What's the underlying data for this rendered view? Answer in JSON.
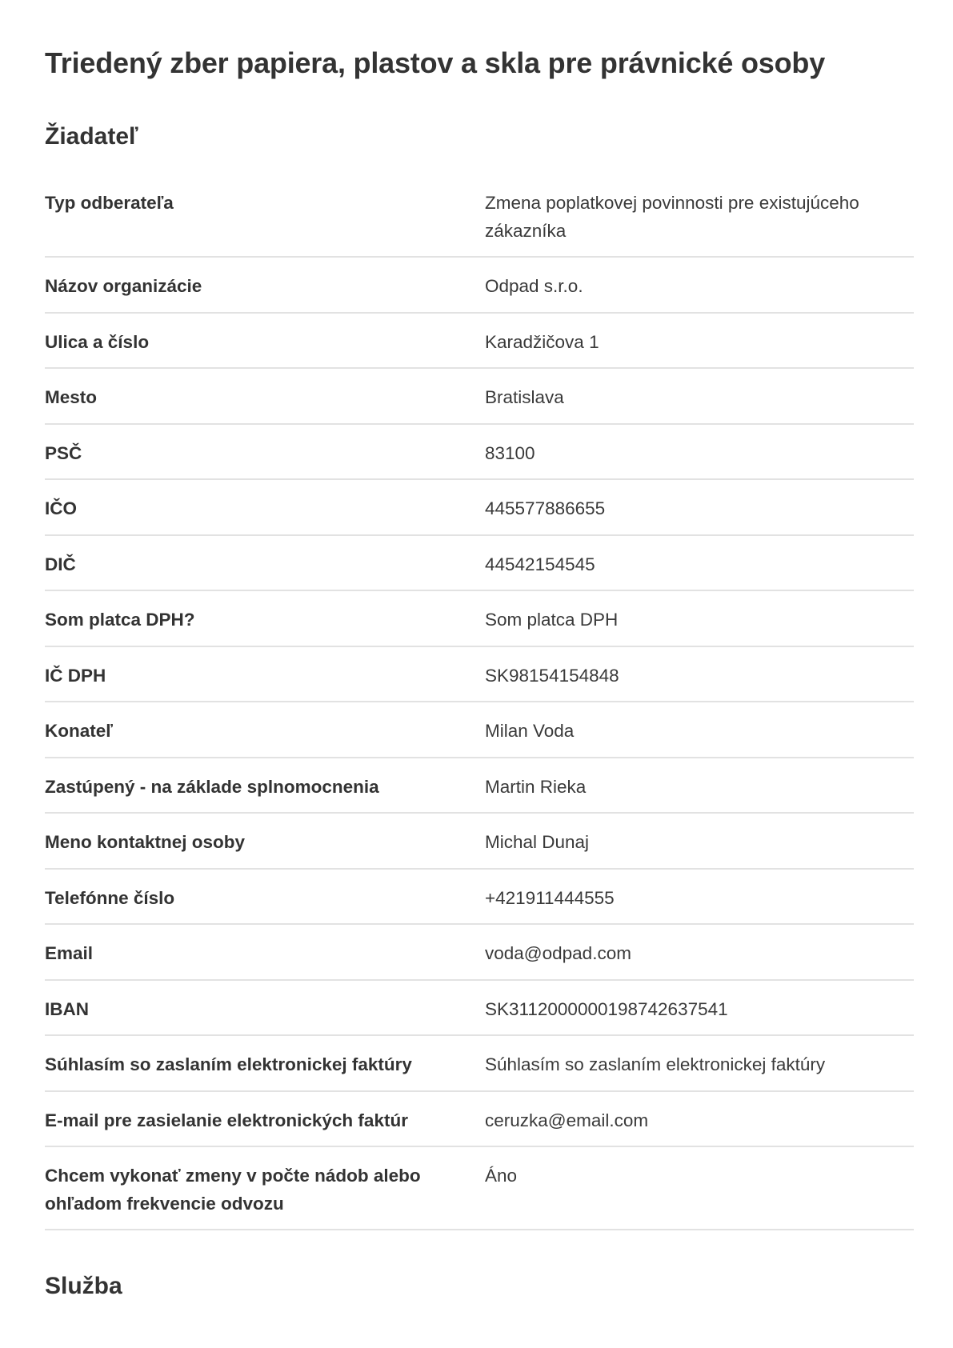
{
  "title": "Triedený zber papiera, plastov a skla pre právnické osoby",
  "sections": {
    "applicant": "Žiadateľ",
    "service": "Služba"
  },
  "fields": [
    {
      "label": "Typ odberateľa",
      "value": "Zmena poplatkovej povinnosti pre existujúceho zákazníka"
    },
    {
      "label": "Názov organizácie",
      "value": "Odpad s.r.o."
    },
    {
      "label": "Ulica a číslo",
      "value": "Karadžičova 1"
    },
    {
      "label": "Mesto",
      "value": "Bratislava"
    },
    {
      "label": "PSČ",
      "value": "83100"
    },
    {
      "label": "IČO",
      "value": "445577886655"
    },
    {
      "label": "DIČ",
      "value": "44542154545"
    },
    {
      "label": "Som platca DPH?",
      "value": "Som platca DPH"
    },
    {
      "label": "IČ DPH",
      "value": "SK98154154848"
    },
    {
      "label": "Konateľ",
      "value": "Milan Voda"
    },
    {
      "label": "Zastúpený - na základe splnomocnenia",
      "value": "Martin Rieka"
    },
    {
      "label": "Meno kontaktnej osoby",
      "value": "Michal Dunaj"
    },
    {
      "label": "Telefónne číslo",
      "value": "+421911444555"
    },
    {
      "label": "Email",
      "value": "voda@odpad.com"
    },
    {
      "label": "IBAN",
      "value": "SK3112000000198742637541"
    },
    {
      "label": "Súhlasím so zaslaním elektronickej faktúry",
      "value": "Súhlasím so zaslaním elektronickej faktúry"
    },
    {
      "label": "E-mail pre zasielanie elektronických faktúr",
      "value": "ceruzka@email.com"
    },
    {
      "label": "Chcem vykonať zmeny v počte nádob alebo ohľadom frekvencie odvozu",
      "value": "Áno"
    }
  ]
}
